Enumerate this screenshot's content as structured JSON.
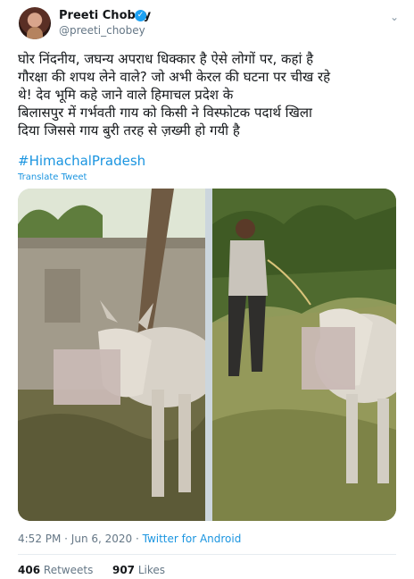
{
  "author": {
    "name": "Preeti Chobey",
    "handle": "@preeti_chobey",
    "verified_icon": "verified-badge-icon"
  },
  "tweet": {
    "lines": [
      "घोर निंदनीय, जघन्य अपराध धिक्कार है ऐसे लोगों पर, कहां है",
      "गौरक्षा की शपथ लेने वाले? जो अभी केरल की घटना पर चीख रहे",
      "थे! देव भूमि कहे जाने वाले हिमाचल प्रदेश के",
      "बिलासपुर में गर्भवती गाय को किसी ने विस्फोटक पदार्थ खिला",
      "दिया जिससे गाय बुरी तरह से ज़ख्मी हो गयी है"
    ],
    "hashtag": "#HimachalPradesh",
    "translate_label": "Translate Tweet"
  },
  "meta": {
    "timestamp": "4:52 PM · Jun 6, 2020 · ",
    "source": "Twitter for Android"
  },
  "stats": {
    "retweets_count": "406",
    "retweets_label": "Retweets",
    "likes_count": "907",
    "likes_label": "Likes"
  },
  "colors": {
    "link": "#1b95e0",
    "verified": "#1da1f2",
    "secondary_text": "#657786"
  }
}
